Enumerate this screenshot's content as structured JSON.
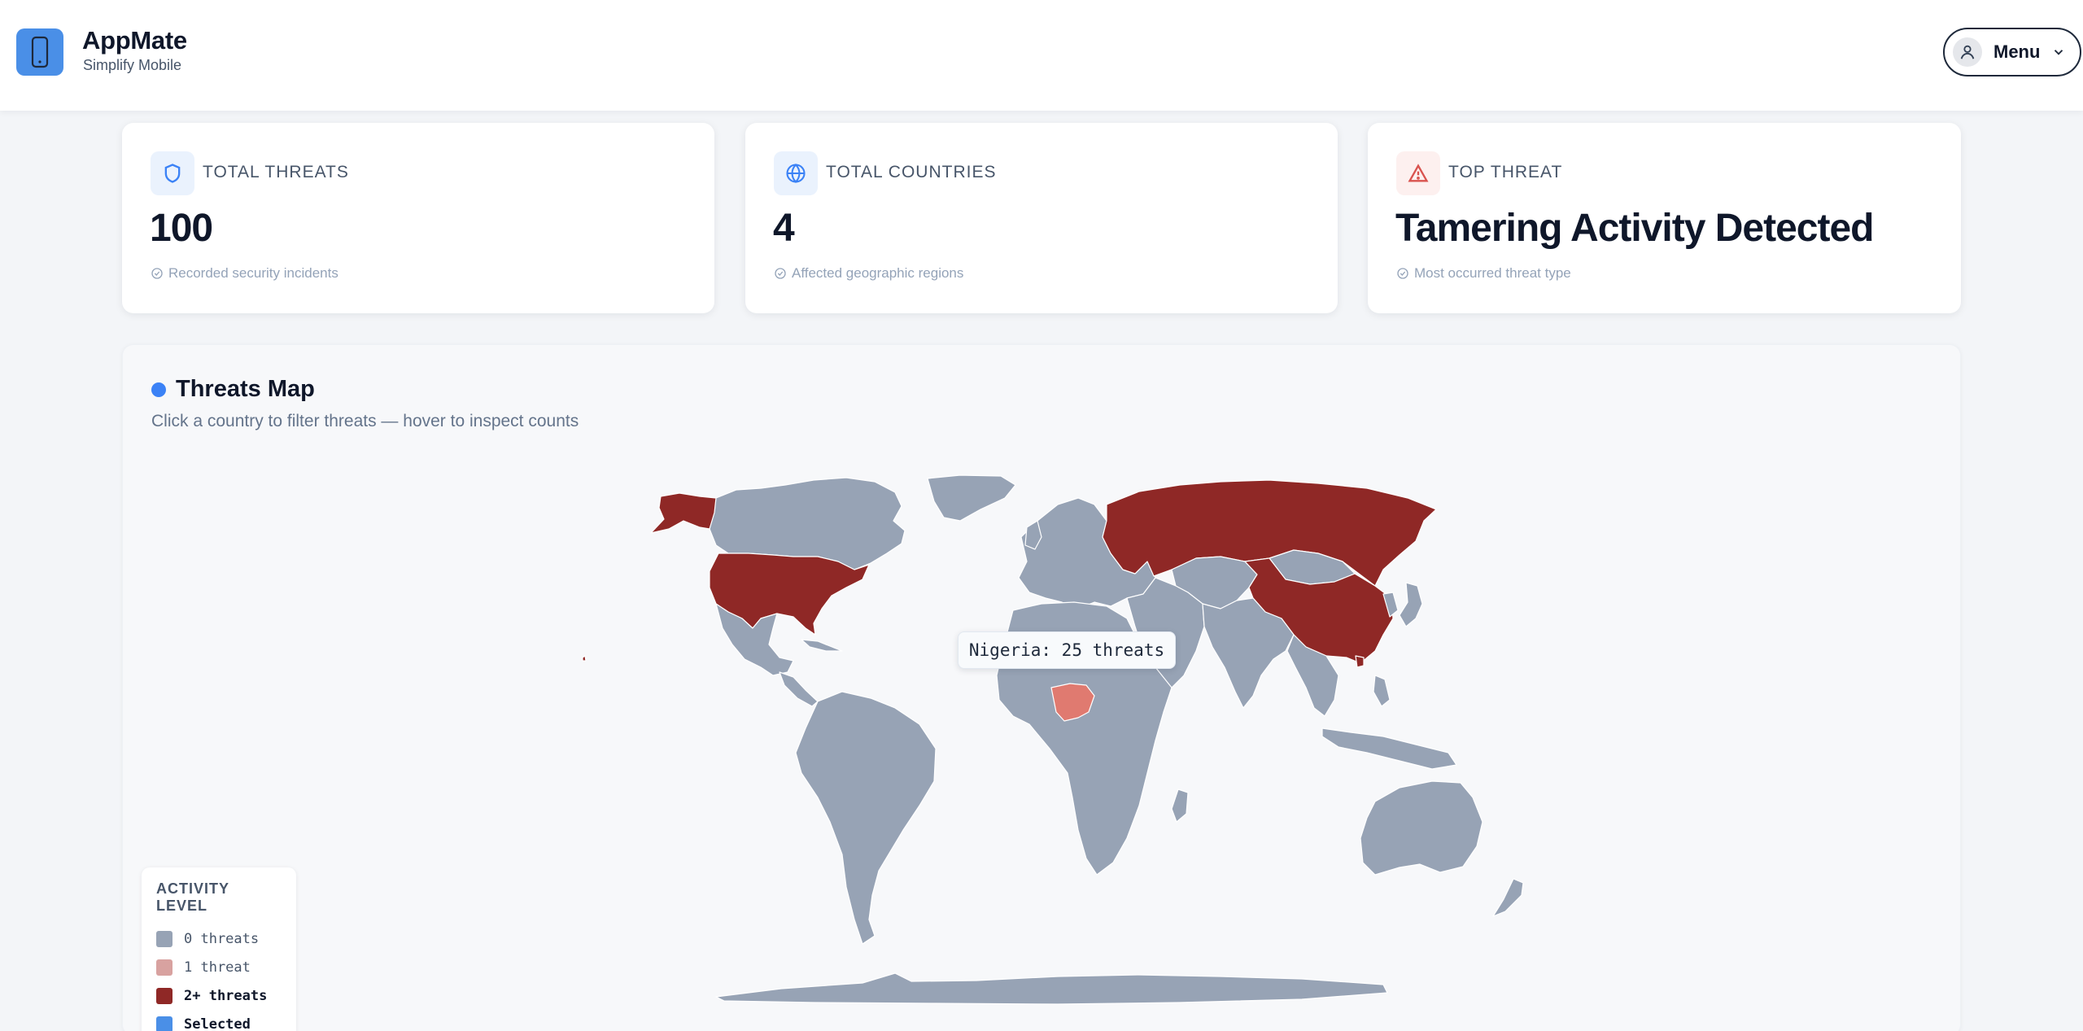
{
  "header": {
    "brand_name": "AppMate",
    "brand_tagline": "Simplify Mobile",
    "menu_label": "Menu"
  },
  "stats": [
    {
      "label": "TOTAL THREATS",
      "value": "100",
      "sub": "Recorded security incidents",
      "icon": "shield-icon",
      "icon_bg": "#eaf2fd",
      "icon_color": "#3b82f6"
    },
    {
      "label": "TOTAL COUNTRIES",
      "value": "4",
      "sub": "Affected geographic regions",
      "icon": "globe-icon",
      "icon_bg": "#eaf2fd",
      "icon_color": "#3b82f6"
    },
    {
      "label": "TOP THREAT",
      "value": "Tamering Activity Detected",
      "sub": "Most occurred threat type",
      "icon": "warning-icon",
      "icon_bg": "#fdf0ef",
      "icon_color": "#d9534f"
    }
  ],
  "map": {
    "title": "Threats Map",
    "subtitle": "Click a country to filter threats — hover to inspect counts",
    "tooltip": "Nigeria: 25 threats",
    "highlighted_countries": [
      "United States",
      "Russia",
      "China",
      "Nigeria"
    ],
    "hovered_country": "Nigeria",
    "colors": {
      "zero": "#97a3b5",
      "one": "#d8a2a0",
      "many": "#8f2826",
      "selected": "#4a8fe7",
      "hover": "#e07a70"
    }
  },
  "legend": {
    "title": "ACTIVITY LEVEL",
    "items": [
      {
        "label": "0 threats",
        "color": "#97a3b5"
      },
      {
        "label": "1 threat",
        "color": "#d8a2a0"
      },
      {
        "label": "2+ threats",
        "color": "#8f2826"
      },
      {
        "label": "Selected",
        "color": "#4a8fe7"
      }
    ]
  }
}
